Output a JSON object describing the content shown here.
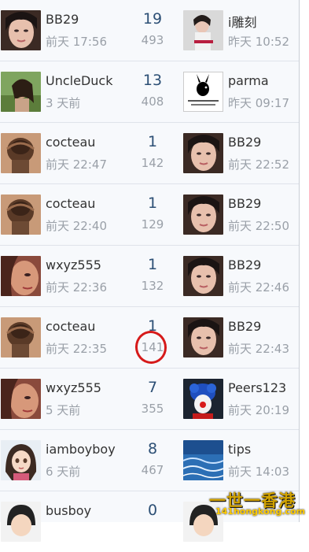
{
  "rows": [
    {
      "left_name": "BB29",
      "left_time": "前天 17:56",
      "replies": "19",
      "views": "493",
      "right_name": "i雕刻",
      "right_time": "昨天 10:52",
      "left_avatar": "woman-portrait-avatar",
      "right_avatar": "woman-portrait-avatar"
    },
    {
      "left_name": "UncleDuck",
      "left_time": "3 天前",
      "replies": "13",
      "views": "408",
      "right_name": "parma",
      "right_time": "昨天 09:17",
      "left_avatar": "woman-portrait-avatar",
      "right_avatar": "playboy-bunny-avatar"
    },
    {
      "left_name": "cocteau",
      "left_time": "前天 22:47",
      "replies": "1",
      "views": "142",
      "right_name": "BB29",
      "right_time": "前天 22:52",
      "left_avatar": "sculpture-avatar",
      "right_avatar": "woman-portrait-avatar"
    },
    {
      "left_name": "cocteau",
      "left_time": "前天 22:40",
      "replies": "1",
      "views": "129",
      "right_name": "BB29",
      "right_time": "前天 22:50",
      "left_avatar": "sculpture-avatar",
      "right_avatar": "woman-portrait-avatar"
    },
    {
      "left_name": "wxyz555",
      "left_time": "前天 22:36",
      "replies": "1",
      "views": "132",
      "right_name": "BB29",
      "right_time": "前天 22:46",
      "left_avatar": "woman-closeup-avatar",
      "right_avatar": "woman-portrait-avatar"
    },
    {
      "left_name": "cocteau",
      "left_time": "前天 22:35",
      "replies": "1",
      "views": "141",
      "right_name": "BB29",
      "right_time": "前天 22:43",
      "left_avatar": "sculpture-avatar",
      "right_avatar": "woman-portrait-avatar"
    },
    {
      "left_name": "wxyz555",
      "left_time": "5 天前",
      "replies": "7",
      "views": "355",
      "right_name": "Peers123",
      "right_time": "前天 20:19",
      "left_avatar": "woman-closeup-avatar",
      "right_avatar": "clown-avatar"
    },
    {
      "left_name": "iamboyboy",
      "left_time": "6 天前",
      "replies": "8",
      "views": "467",
      "right_name": "tips",
      "right_time": "前天 14:03",
      "left_avatar": "cartoon-girl-avatar",
      "right_avatar": "ocean-avatar"
    },
    {
      "left_name": "busboy",
      "left_time": "",
      "replies": "0",
      "views": "",
      "right_name": "",
      "right_time": "",
      "left_avatar": "cartoon-boy-avatar",
      "right_avatar": "cartoon-boy-avatar"
    }
  ],
  "watermark": {
    "chinese": "一世一香港",
    "url": "141hongkong.com"
  },
  "colors": {
    "accent": "#2c4f75",
    "muted": "#9aa0a8",
    "annotation": "#d61a1a",
    "watermark": "#d2a300"
  }
}
